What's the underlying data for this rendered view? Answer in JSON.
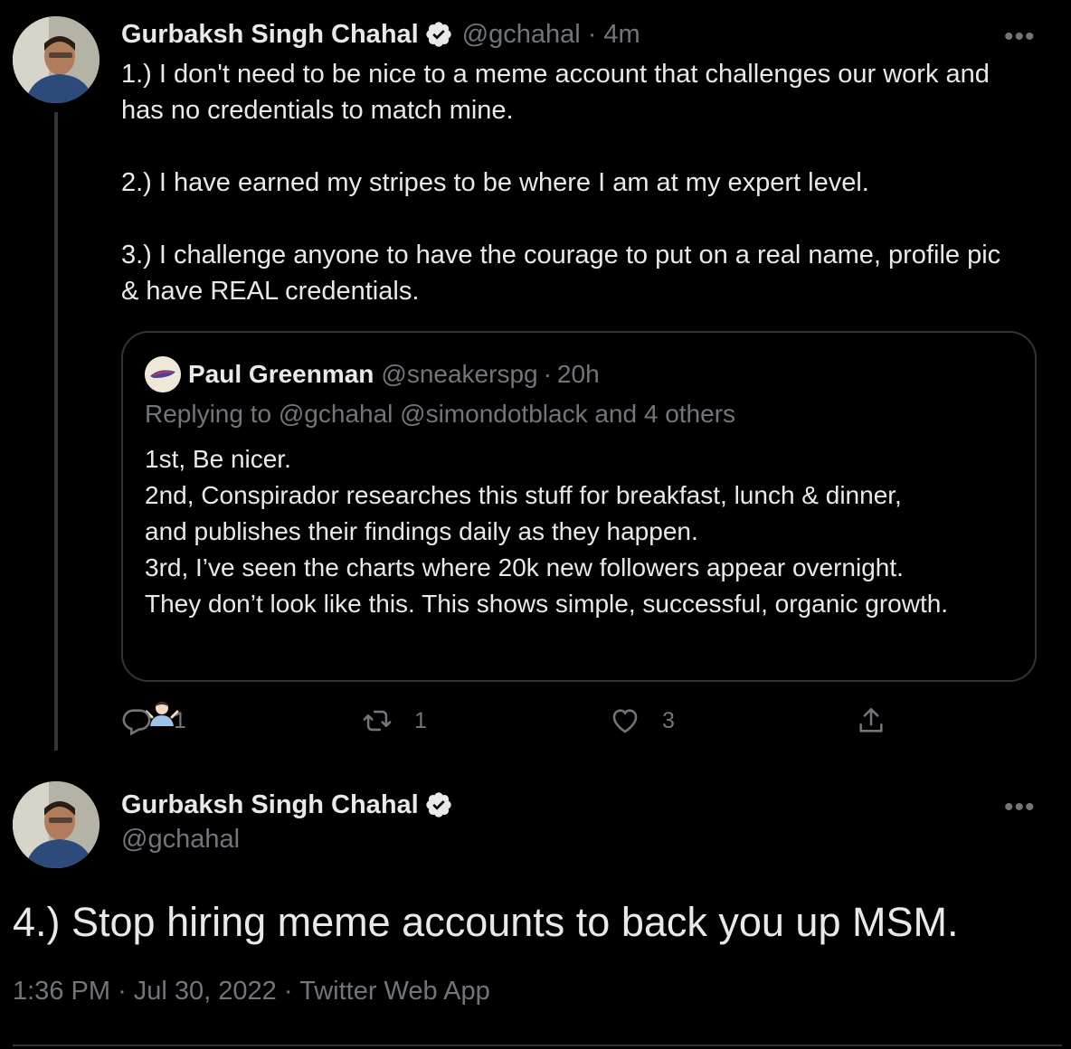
{
  "first_tweet": {
    "author_name": "Gurbaksh Singh Chahal",
    "handle": "@gchahal",
    "time": "4m",
    "separator": "·",
    "text": "1.) I don't need to be nice to a meme account that challenges our work and\nhas no credentials to match mine.\n\n2.) I have earned my stripes to be where I am at my expert level.\n\n3.) I challenge anyone to have the courage to put on a real name, profile pic\n& have REAL credentials.",
    "more_label": "•••",
    "quote": {
      "author_name": "Paul Greenman",
      "handle": "@sneakerspg",
      "time": "20h",
      "separator": "·",
      "replying_prefix": "Replying to",
      "replying_to": "@gchahal @simondotblack",
      "replying_suffix": "and 4 others",
      "text": "1st, Be nicer.\n2nd, Conspirador researches this stuff for breakfast, lunch & dinner,\nand publishes their findings daily as they happen.\n3rd, I’ve seen the charts where 20k new followers appear overnight.\nThey don’t look like this. This shows simple, successful, organic growth.",
      "emoji": "person-shrugging-emoji"
    },
    "actions": {
      "reply_count": "1",
      "retweet_count": "1",
      "like_count": "3",
      "reply_icon": "reply-icon",
      "retweet_icon": "retweet-icon",
      "like_icon": "heart-icon",
      "share_icon": "share-icon"
    }
  },
  "second_tweet": {
    "author_name": "Gurbaksh Singh Chahal",
    "handle": "@gchahal",
    "more_label": "•••",
    "text": "4.) Stop hiring meme accounts to back you up MSM.",
    "time": "1:36 PM",
    "date": "Jul 30, 2022",
    "separator": "·",
    "source": "Twitter Web App"
  },
  "colors": {
    "background": "#000000",
    "text": "#e7e9ea",
    "muted": "#71767b",
    "border": "#2f3336"
  }
}
